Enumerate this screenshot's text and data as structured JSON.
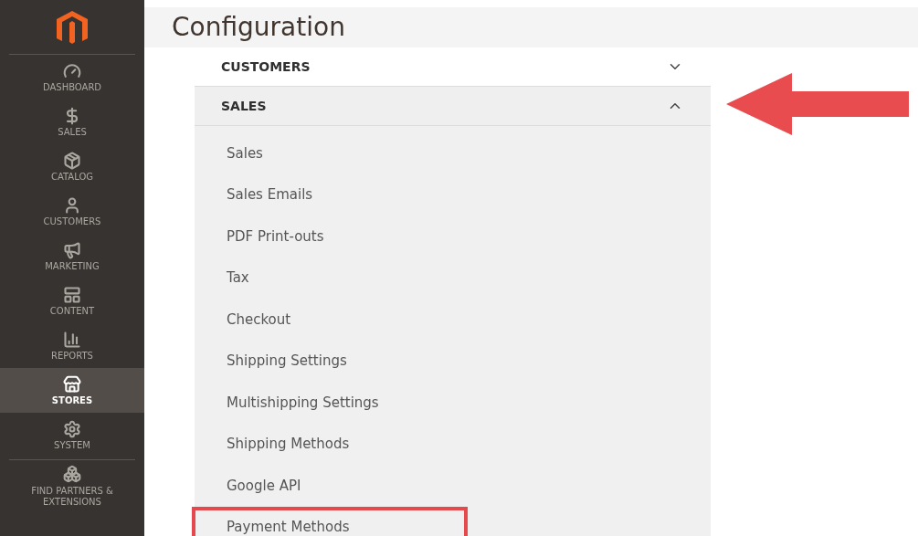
{
  "sidebar": {
    "items": [
      {
        "label": "DASHBOARD",
        "selected": false
      },
      {
        "label": "SALES",
        "selected": false
      },
      {
        "label": "CATALOG",
        "selected": false
      },
      {
        "label": "CUSTOMERS",
        "selected": false
      },
      {
        "label": "MARKETING",
        "selected": false
      },
      {
        "label": "CONTENT",
        "selected": false
      },
      {
        "label": "REPORTS",
        "selected": false
      },
      {
        "label": "STORES",
        "selected": true
      },
      {
        "label": "SYSTEM",
        "selected": false
      }
    ],
    "extra": {
      "label": "FIND PARTNERS & EXTENSIONS"
    }
  },
  "page": {
    "title": "Configuration"
  },
  "sections": [
    {
      "label": "CUSTOMERS",
      "expanded": false
    },
    {
      "label": "SALES",
      "expanded": true,
      "items": [
        {
          "label": "Sales",
          "highlighted": false
        },
        {
          "label": "Sales Emails",
          "highlighted": false
        },
        {
          "label": "PDF Print-outs",
          "highlighted": false
        },
        {
          "label": "Tax",
          "highlighted": false
        },
        {
          "label": "Checkout",
          "highlighted": false
        },
        {
          "label": "Shipping Settings",
          "highlighted": false
        },
        {
          "label": "Multishipping Settings",
          "highlighted": false
        },
        {
          "label": "Shipping Methods",
          "highlighted": false
        },
        {
          "label": "Google API",
          "highlighted": false
        },
        {
          "label": "Payment Methods",
          "highlighted": true
        }
      ]
    }
  ]
}
